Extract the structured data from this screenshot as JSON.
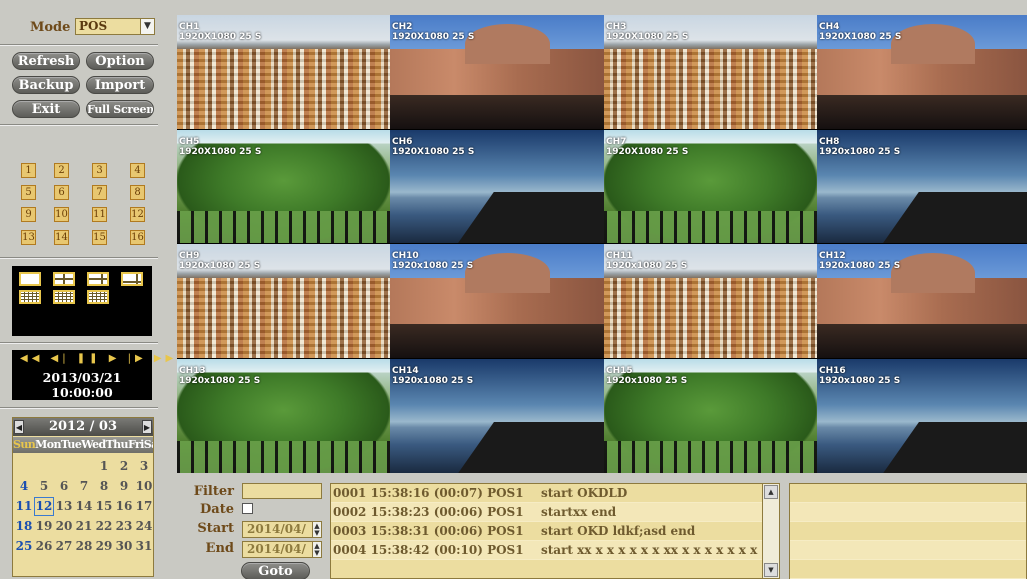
{
  "mode": {
    "label": "Mode",
    "value": "POS"
  },
  "buttons": {
    "refresh": "Refresh",
    "option": "Option",
    "backup": "Backup",
    "import": "Import",
    "exit": "Exit",
    "full_screen": "Full Screen"
  },
  "channels": [
    "1",
    "2",
    "3",
    "4",
    "5",
    "6",
    "7",
    "8",
    "9",
    "10",
    "11",
    "12",
    "13",
    "14",
    "15",
    "16"
  ],
  "playback": {
    "controls_text": "◀◀ ◀| ❚❚ ▶ |▶ ▶▶",
    "datetime": "2013/03/21 10:00:00"
  },
  "calendar": {
    "title": "2012 / 03",
    "weekdays_sun": "Sun",
    "weekdays_rest": "MonTueWedThuFriSat",
    "rows": [
      [
        "",
        "",
        "",
        "",
        "1",
        "2",
        "3"
      ],
      [
        "4",
        "5",
        "6",
        "7",
        "8",
        "9",
        "10"
      ],
      [
        "11",
        "12",
        "13",
        "14",
        "15",
        "16",
        "17"
      ],
      [
        "18",
        "19",
        "20",
        "21",
        "22",
        "23",
        "24"
      ],
      [
        "25",
        "26",
        "27",
        "28",
        "29",
        "30",
        "31"
      ]
    ],
    "selected": "12"
  },
  "tiles": [
    {
      "ch": "CH1",
      "res": "1920X1080 25 S"
    },
    {
      "ch": "CH2",
      "res": "1920X1080 25 S"
    },
    {
      "ch": "CH3",
      "res": "1920X1080 25 S"
    },
    {
      "ch": "CH4",
      "res": "1920X1080 25 S"
    },
    {
      "ch": "CH5",
      "res": "1920X1080 25 S"
    },
    {
      "ch": "CH6",
      "res": "1920X1080 25 S"
    },
    {
      "ch": "CH7",
      "res": "1920X1080 25 S"
    },
    {
      "ch": "CH8",
      "res": "1920x1080 25 S"
    },
    {
      "ch": "CH9",
      "res": "1920x1080 25 S"
    },
    {
      "ch": "CH10",
      "res": "1920x1080 25 S"
    },
    {
      "ch": "CH11",
      "res": "1920x1080 25 S"
    },
    {
      "ch": "CH12",
      "res": "1920x1080 25 S"
    },
    {
      "ch": "CH13",
      "res": "1920x1080 25 S"
    },
    {
      "ch": "CH14",
      "res": "1920x1080 25 S"
    },
    {
      "ch": "CH15",
      "res": "1920x1080 25 S"
    },
    {
      "ch": "CH16",
      "res": "1920x1080 25 S"
    }
  ],
  "filter": {
    "filter_label": "Filter",
    "date_label": "Date",
    "start_label": "Start",
    "start_value": "2014/04/",
    "end_label": "End",
    "end_value": "2014/04/",
    "goto_label": "Goto"
  },
  "log": [
    {
      "id": "0001 15:38:16 (00:07) POS1",
      "msg": "start OKDLD"
    },
    {
      "id": "0002 15:38:23 (00:06) POS1",
      "msg": "startxx end"
    },
    {
      "id": "0003 15:38:31 (00:06) POS1",
      "msg": "start OKD ldkf;asd end"
    },
    {
      "id": "0004 15:38:42 (00:10) POS1",
      "msg": "start xx x x x x x x xx x x x x x x x"
    }
  ]
}
